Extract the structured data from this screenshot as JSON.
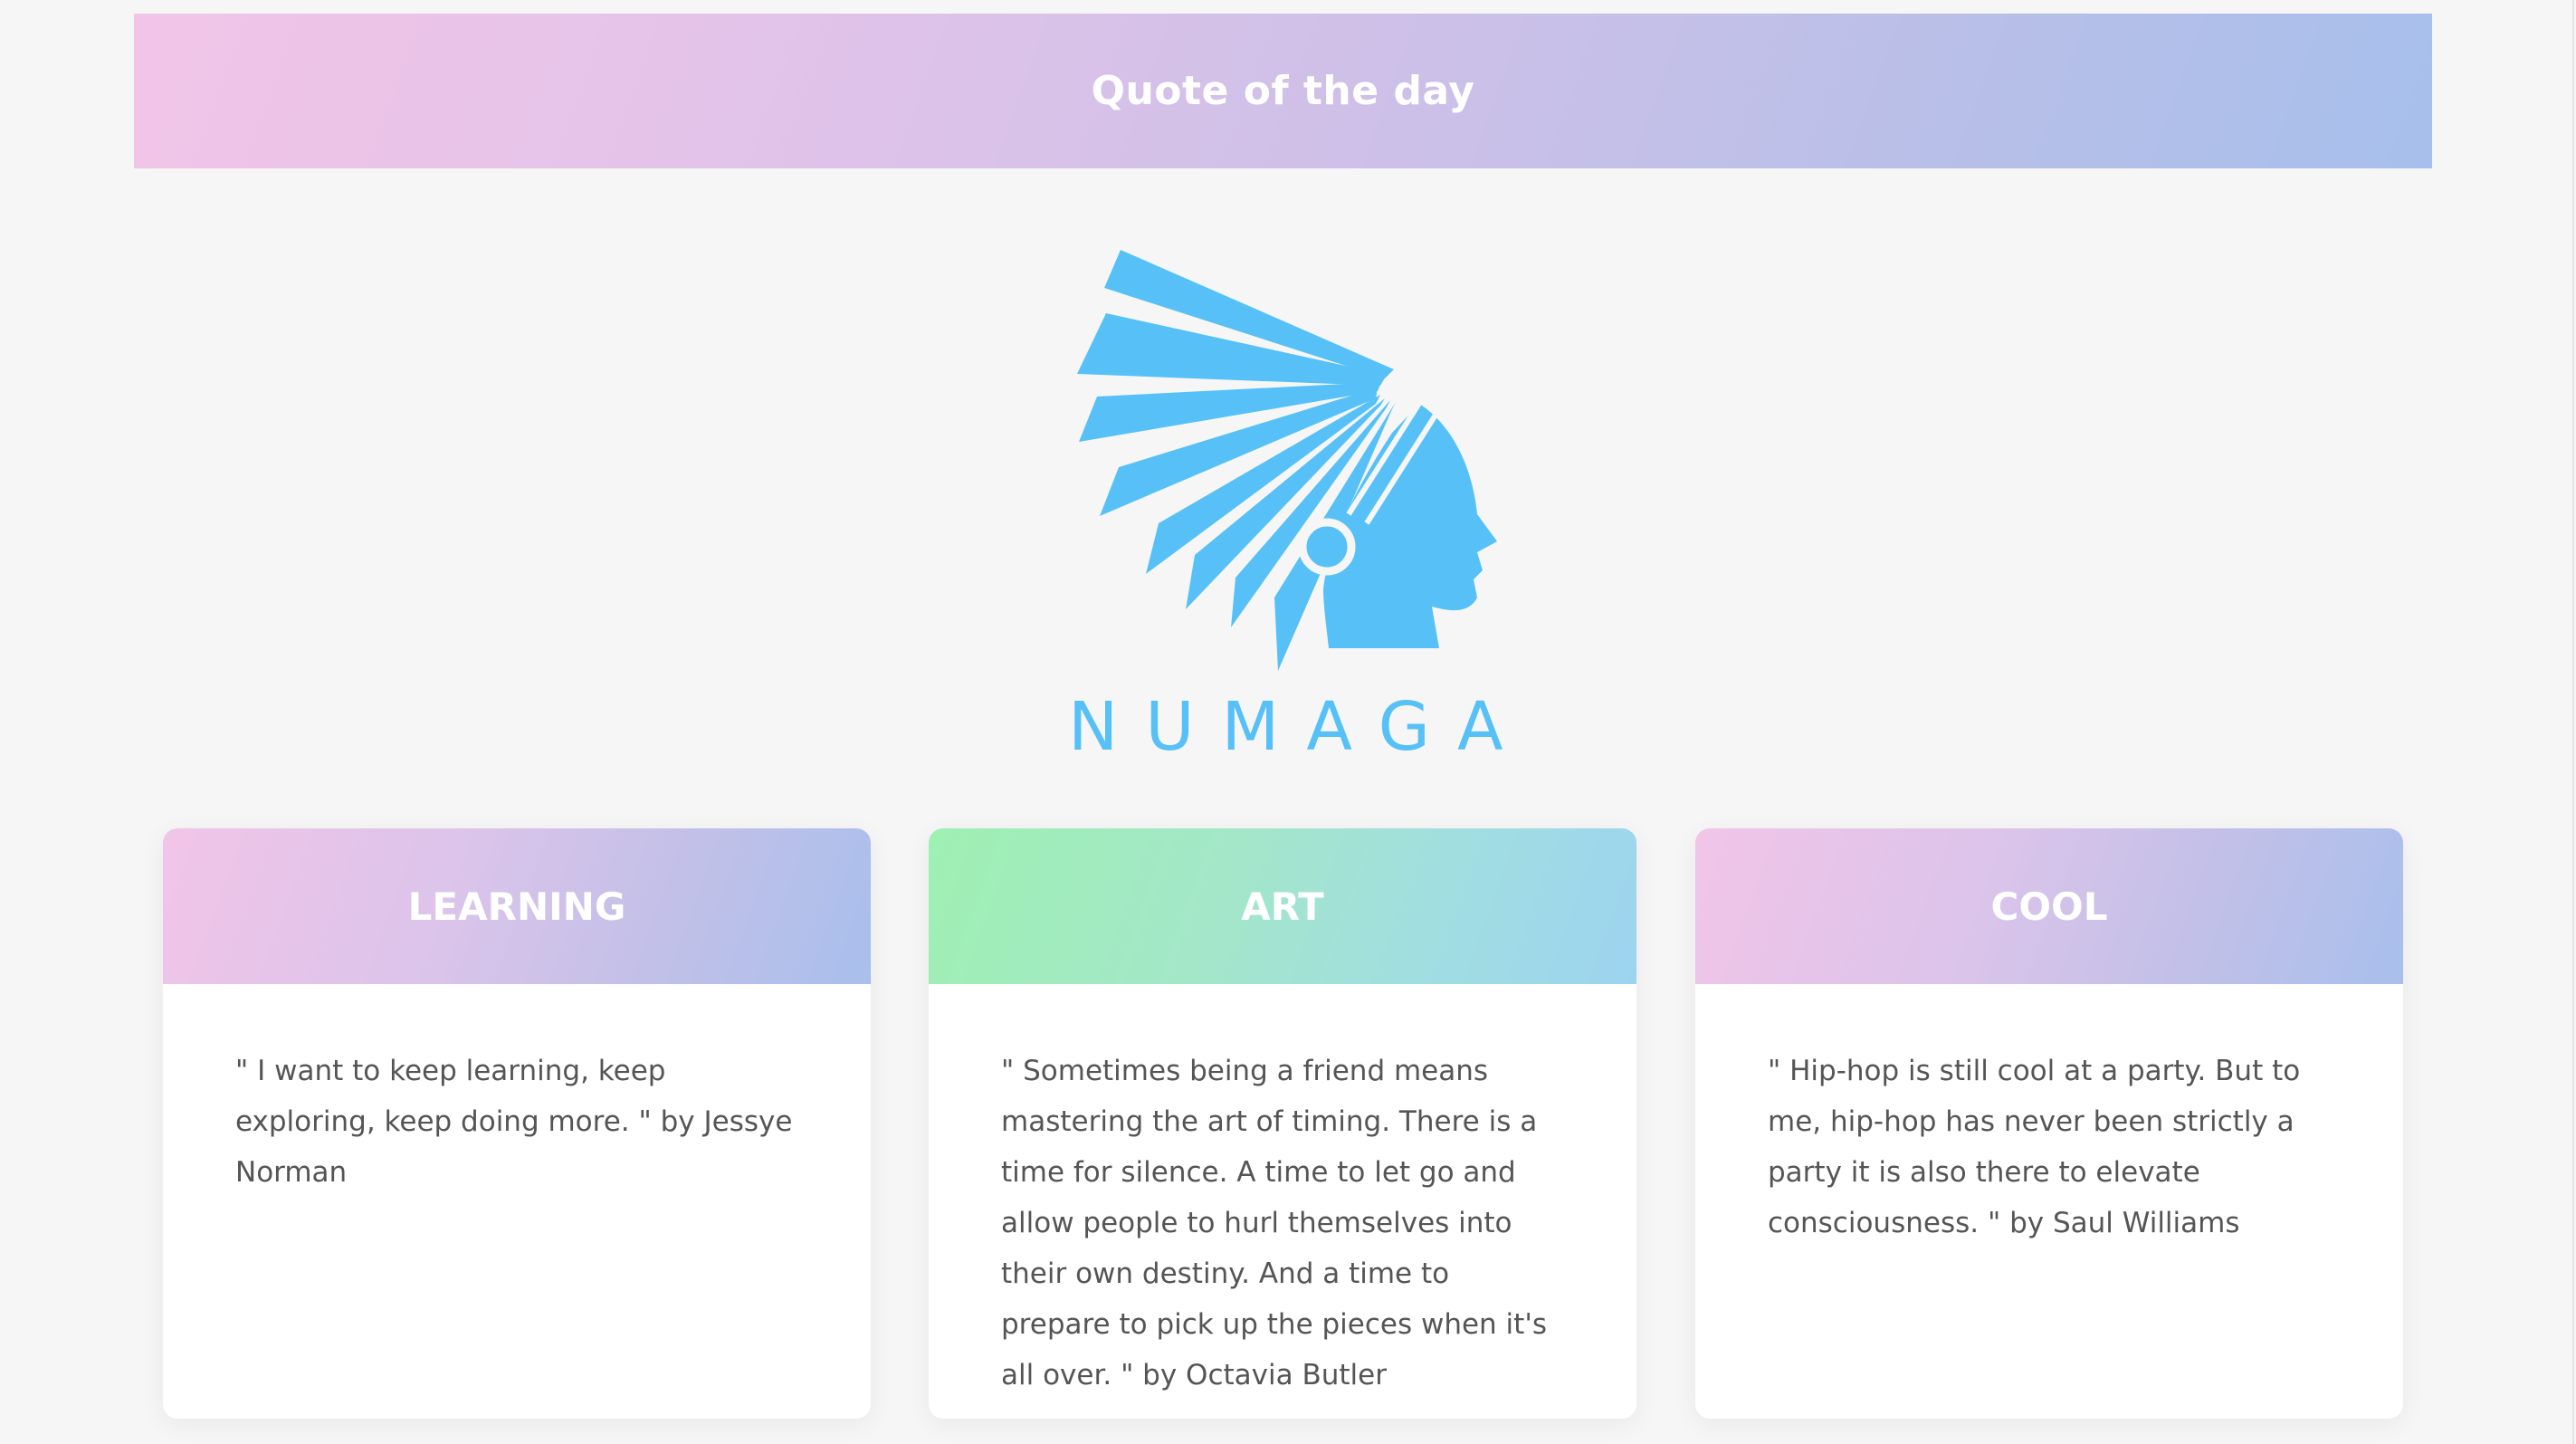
{
  "banner": {
    "title": "Quote of the day"
  },
  "logo": {
    "name": "NUMAGA",
    "icon": "native-headdress-profile-logo",
    "color": "#57c1f7"
  },
  "cards": [
    {
      "title": "LEARNING",
      "quote": "\" I want to keep learning, keep exploring, keep doing more. \" by Jessye Norman",
      "header_gradient": [
        "#f1c5e8",
        "#a8bfec"
      ]
    },
    {
      "title": "ART",
      "quote": "\" Sometimes being a friend means mastering the art of timing. There is a time for silence. A time to let go and allow people to hurl themselves into their own destiny. And a time to prepare to pick up the pieces when it's all over. \" by Octavia Butler",
      "header_gradient": [
        "#9ff0b2",
        "#9dd3f0"
      ]
    },
    {
      "title": "COOL",
      "quote": "\" Hip-hop is still cool at a party. But to me, hip-hop has never been strictly a party it is also there to elevate consciousness. \" by Saul Williams",
      "header_gradient": [
        "#f1c5e8",
        "#a8bfec"
      ]
    }
  ],
  "colors": {
    "background": "#f6f6f6",
    "text": "#555555"
  }
}
